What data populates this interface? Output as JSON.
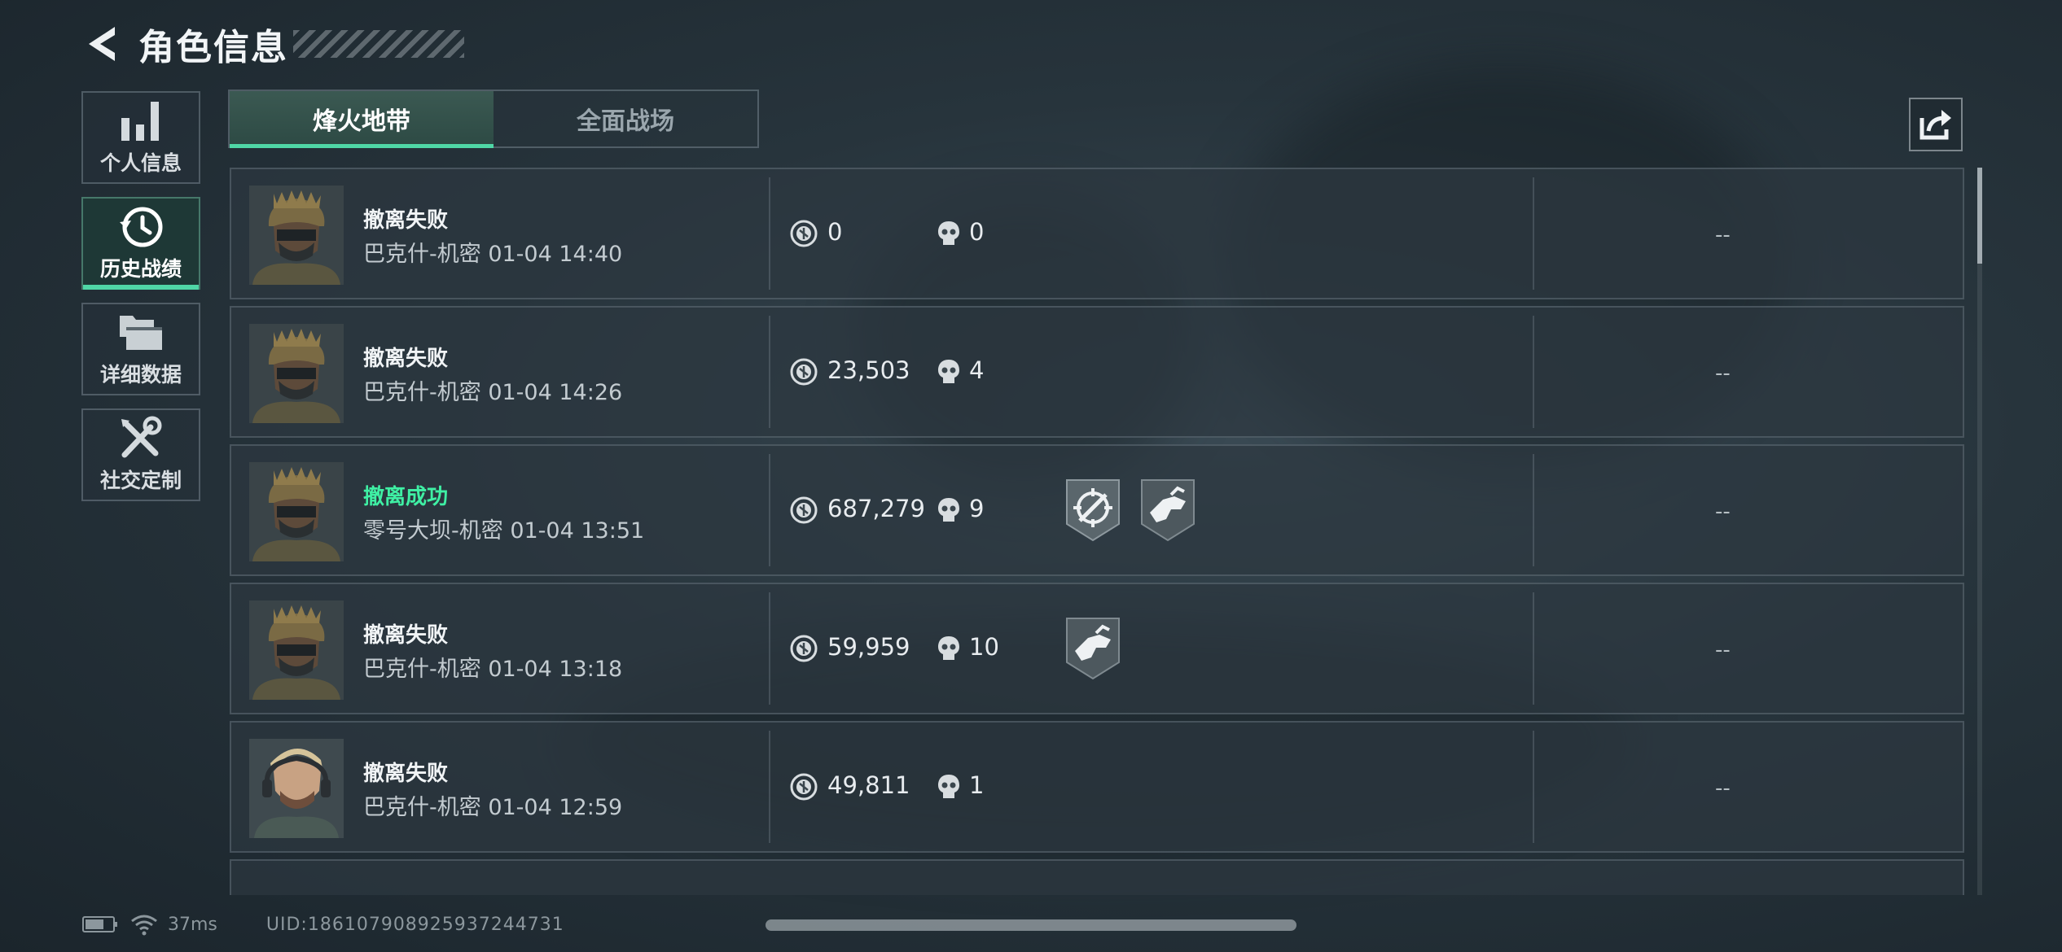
{
  "header": {
    "title": "角色信息"
  },
  "nav": {
    "items": [
      {
        "label": "个人信息",
        "icon": "bar-chart-icon"
      },
      {
        "label": "历史战绩",
        "icon": "history-clock-icon"
      },
      {
        "label": "详细数据",
        "icon": "folders-icon"
      },
      {
        "label": "社交定制",
        "icon": "tools-icon"
      }
    ],
    "active_index": 1
  },
  "tabs": [
    {
      "label": "烽火地带",
      "active": true
    },
    {
      "label": "全面战场",
      "active": false
    }
  ],
  "records": [
    {
      "status": "撤离失败",
      "success": false,
      "map": "巴克什-机密 01-04 14:40",
      "value": "0",
      "kills": "0",
      "badges": [],
      "extra": "--",
      "avatar": "operator-helmet"
    },
    {
      "status": "撤离失败",
      "success": false,
      "map": "巴克什-机密 01-04 14:26",
      "value": "23,503",
      "kills": "4",
      "badges": [],
      "extra": "--",
      "avatar": "operator-helmet"
    },
    {
      "status": "撤离成功",
      "success": true,
      "map": "零号大坝-机密 01-04 13:51",
      "value": "687,279",
      "kills": "9",
      "badges": [
        "crosshair-rifle-badge",
        "hand-gun-badge"
      ],
      "extra": "--",
      "avatar": "operator-helmet"
    },
    {
      "status": "撤离失败",
      "success": false,
      "map": "巴克什-机密 01-04 13:18",
      "value": "59,959",
      "kills": "10",
      "badges": [
        "hand-gun-badge"
      ],
      "extra": "--",
      "avatar": "operator-helmet"
    },
    {
      "status": "撤离失败",
      "success": false,
      "map": "巴克什-机密 01-04 12:59",
      "value": "49,811",
      "kills": "1",
      "badges": [],
      "extra": "--",
      "avatar": "operator-headset"
    }
  ],
  "footer": {
    "ping": "37ms",
    "uid": "UID:1861079089259372447​31"
  },
  "colors": {
    "accent": "#4fd7a6",
    "success": "#3ff0a4"
  }
}
